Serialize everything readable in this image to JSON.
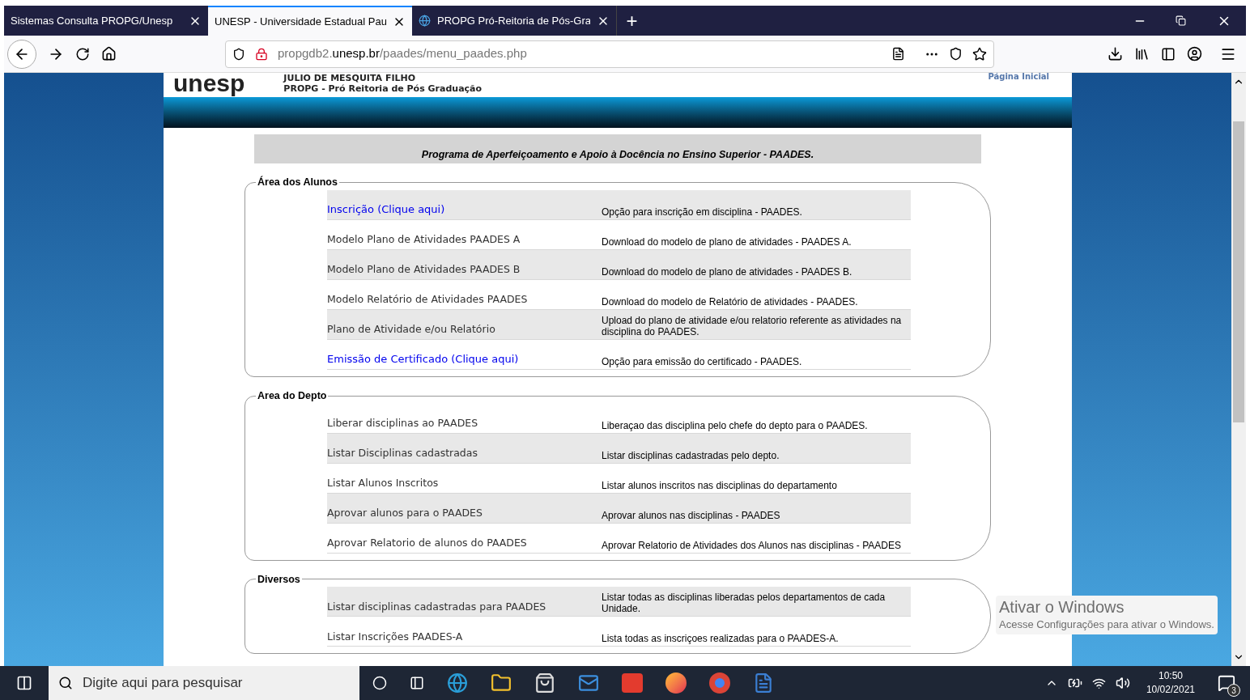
{
  "browser": {
    "tabs": [
      {
        "label": "Sistemas Consulta PROPG/Unesp",
        "selected": false,
        "favicon": false
      },
      {
        "label": "UNESP - Universidade Estadual Pau",
        "selected": true,
        "favicon": false
      },
      {
        "label": "PROPG Pró-Reitoria de Pós-Gra",
        "selected": false,
        "favicon": true
      }
    ],
    "new_tab": "+",
    "url_host": "propgdb2.",
    "url_domain": "unesp.br",
    "url_path": "/paades/menu_paades.php"
  },
  "header": {
    "logo": "unesp",
    "university": "JULIO DE MESQUITA FILHO",
    "unit": "PROPG - Pró Reitoria de Pós Graduação",
    "home_link": "Página Inicial"
  },
  "title": "Programa de Aperfeiçoamento e Apoio à Docência no Ensino Superior - PAADES.",
  "sections": [
    {
      "legend": "Área dos Alunos",
      "rows": [
        {
          "kind": "link",
          "label": "Inscrição (Clique aqui)",
          "description": "Opção para inscrição em disciplina - PAADES.",
          "shaded": true
        },
        {
          "kind": "text",
          "label": "Modelo Plano de Atividades PAADES A",
          "description": "Download do modelo de plano de atividades - PAADES A.",
          "shaded": false
        },
        {
          "kind": "text",
          "label": "Modelo Plano de Atividades PAADES B",
          "description": "Download do modelo de plano de atividades - PAADES B.",
          "shaded": true
        },
        {
          "kind": "text",
          "label": "Modelo Relatório de Atividades PAADES",
          "description": "Download do modelo de Relatório de atividades - PAADES.",
          "shaded": false
        },
        {
          "kind": "text",
          "label": "Plano de Atividade e/ou Relatório",
          "description": "Upload do plano de atividade e/ou relatorio referente as atividades na disciplina do PAADES.",
          "shaded": true
        },
        {
          "kind": "link",
          "label": "Emissão de Certificado (Clique aqui)",
          "description": "Opção para emissão do certificado - PAADES.",
          "shaded": false
        }
      ]
    },
    {
      "legend": "Area do Depto",
      "rows": [
        {
          "kind": "text",
          "label": "Liberar disciplinas ao PAADES",
          "description": "Liberaçao das disciplina pelo chefe do depto para o PAADES.",
          "shaded": false
        },
        {
          "kind": "text",
          "label": "Listar Disciplinas cadastradas",
          "description": "Listar disciplinas cadastradas pelo depto.",
          "shaded": true
        },
        {
          "kind": "text",
          "label": "Listar Alunos Inscritos",
          "description": "Listar alunos inscritos nas disciplinas do departamento",
          "shaded": false
        },
        {
          "kind": "text",
          "label": "Aprovar alunos para o PAADES",
          "description": "Aprovar alunos nas disciplinas - PAADES",
          "shaded": true
        },
        {
          "kind": "text",
          "label": "Aprovar Relatorio de alunos do PAADES",
          "description": "Aprovar Relatorio de Atividades dos Alunos nas disciplinas - PAADES",
          "shaded": false
        }
      ]
    },
    {
      "legend": "Diversos",
      "rows": [
        {
          "kind": "text",
          "label": "Listar disciplinas cadastradas para PAADES",
          "description": "Listar todas as disciplinas liberadas pelos departamentos de cada Unidade.",
          "shaded": true
        },
        {
          "kind": "text",
          "label": "Listar Inscrições PAADES-A",
          "description": "Lista todas as inscriçoes realizadas para o PAADES-A.",
          "shaded": false
        }
      ]
    }
  ],
  "activation": {
    "title": "Ativar o Windows",
    "subtitle": "Acesse Configurações para ativar o Windows."
  },
  "taskbar": {
    "search_placeholder": "Digite aqui para pesquisar",
    "time": "10:50",
    "date": "10/02/2021",
    "notifications": "3"
  }
}
